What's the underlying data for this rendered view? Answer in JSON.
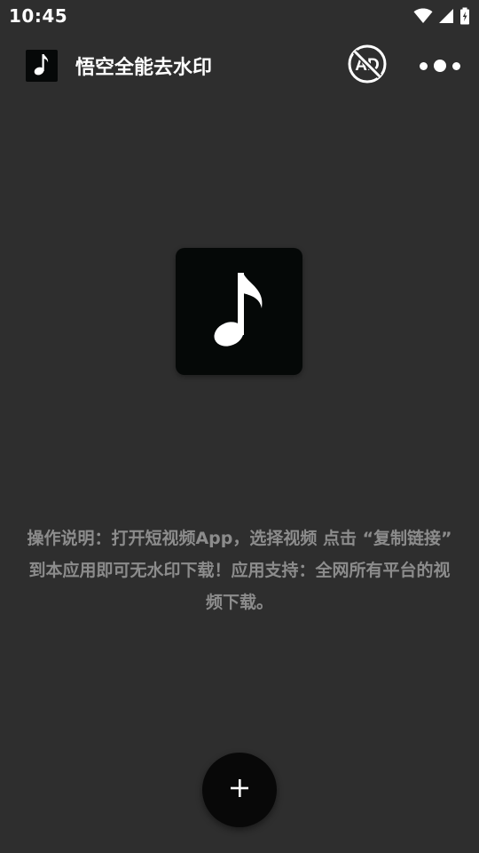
{
  "status_bar": {
    "time": "10:45",
    "icons": [
      "wifi-icon",
      "cell-signal-icon",
      "battery-icon"
    ]
  },
  "app_bar": {
    "logo_icon": "music-note-icon",
    "title": "悟空全能去水印",
    "ad_button_icon": "no-ad-icon",
    "ad_button_text": "AD",
    "more_icon": "more-dots-icon"
  },
  "main": {
    "center_icon": "music-note-icon",
    "instructions": "操作说明：打开短视频App，选择视频 点击 “复制链接” 到本应用即可无水印下载！应用支持：全网所有平台的视频下载。"
  },
  "fab": {
    "icon": "plus-icon",
    "label": "+"
  },
  "colors": {
    "background": "#2e2e2e",
    "tile": "#050807",
    "instruction_text": "#8c8c8c",
    "fab": "#080808"
  }
}
